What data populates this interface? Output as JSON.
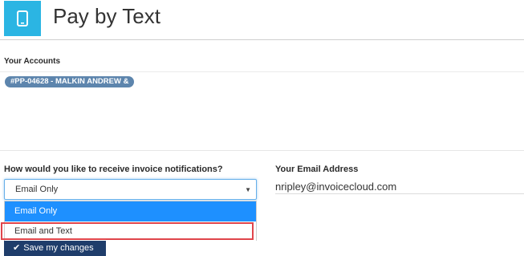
{
  "header": {
    "icon": "mobile-phone-icon",
    "title": "Pay by Text",
    "icon_bg_color": "#2bb5e3"
  },
  "accounts": {
    "label": "Your Accounts",
    "items": [
      {
        "label": "#PP-04628 - MALKIN ANDREW &"
      }
    ],
    "pill_color": "#5d85ad"
  },
  "notifications": {
    "label": "How would you like to receive invoice notifications?",
    "selected": "Email Only",
    "options": [
      {
        "label": "Email Only",
        "highlighted": true
      },
      {
        "label": "Email and Text",
        "highlighted": false
      }
    ],
    "highlight_color": "#1e90ff",
    "annotation_color": "#e0454b"
  },
  "email": {
    "label": "Your Email Address",
    "value": "nripley@invoicecloud.com"
  },
  "save": {
    "icon": "checkmark-icon",
    "label": "Save my changes",
    "color": "#1f3d6b"
  }
}
